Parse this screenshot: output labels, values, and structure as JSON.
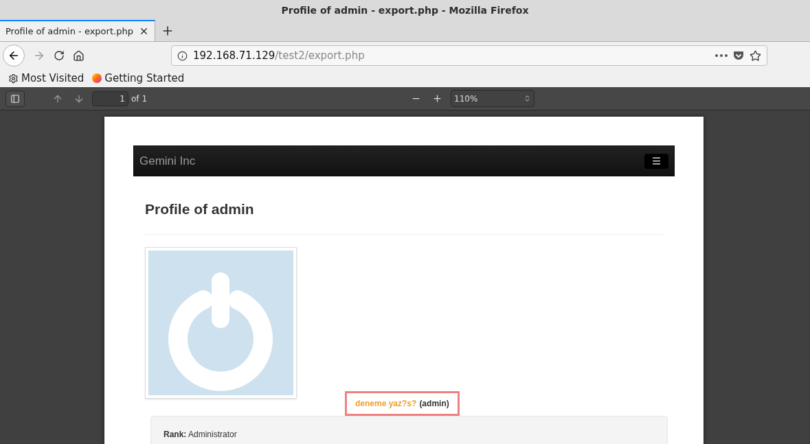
{
  "window": {
    "title": "Profile of admin - export.php - Mozilla Firefox"
  },
  "tabs": [
    {
      "label": "Profile of admin - export.php",
      "selected": true
    }
  ],
  "address": {
    "host": "192.168.71.129",
    "path": "/test2/export.php"
  },
  "bookmarks": [
    {
      "label": "Most Visited",
      "kind": "gear"
    },
    {
      "label": "Getting Started",
      "kind": "firefox"
    }
  ],
  "pdf_toolbar": {
    "page": "1",
    "page_count": "of 1",
    "zoom": "110%"
  },
  "document": {
    "brand": "Gemini Inc",
    "heading": "Profile of admin",
    "display_name": "deneme yaz?s?",
    "username": "(admin)",
    "details": [
      "**Rank:** Administrator"
    ]
  }
}
